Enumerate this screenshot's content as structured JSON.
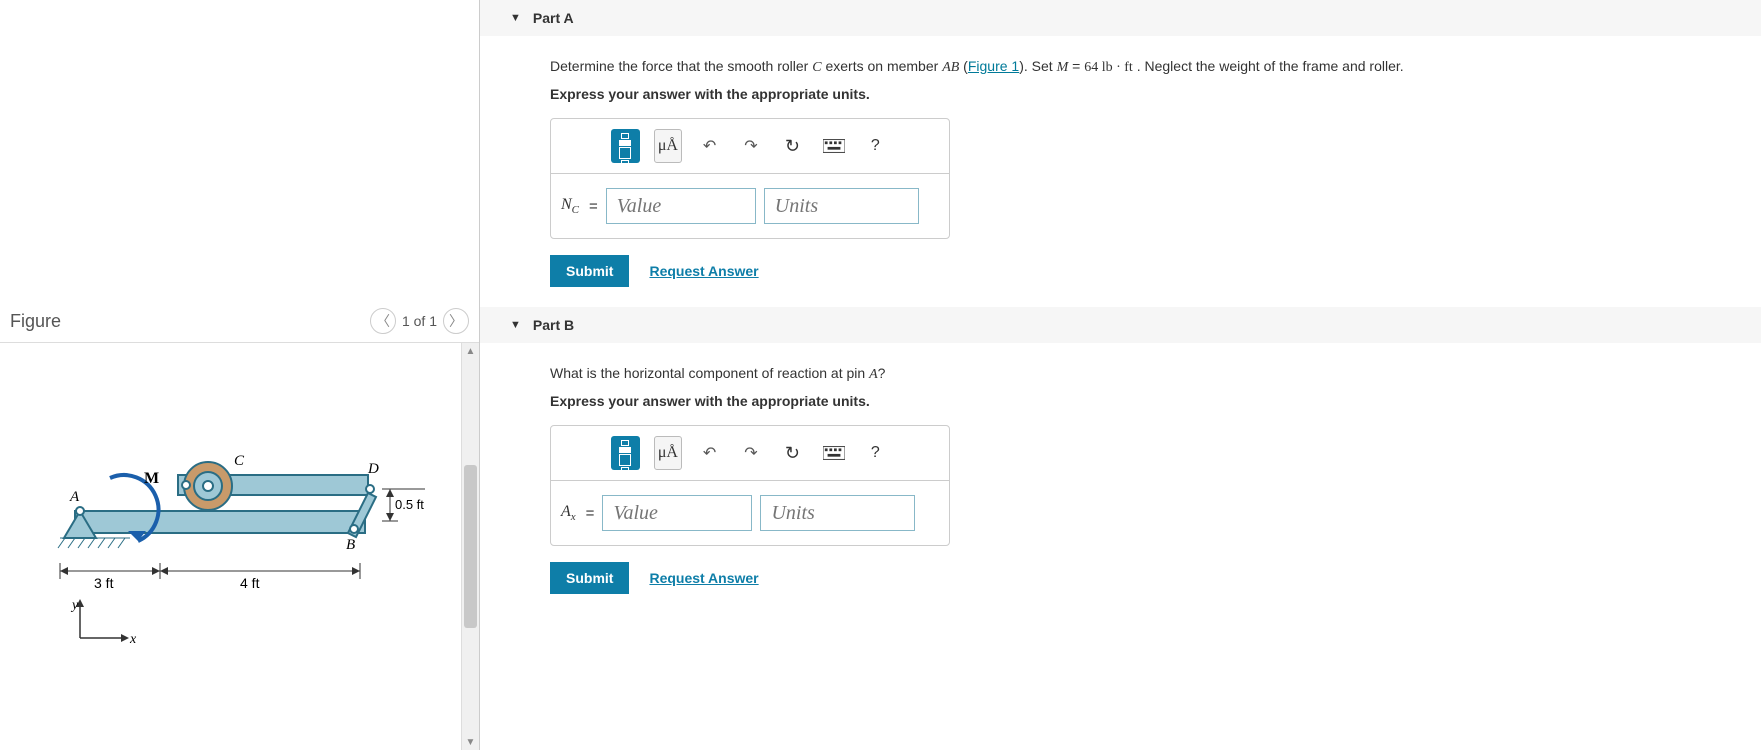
{
  "figure": {
    "title": "Figure",
    "pager": "1 of 1",
    "labels": {
      "A": "A",
      "B": "B",
      "C": "C",
      "D": "D",
      "M": "M",
      "dim1": "3 ft",
      "dim2": "4 ft",
      "dim3": "0.5 ft",
      "axis_x": "x",
      "axis_y": "y"
    }
  },
  "partA": {
    "header": "Part A",
    "q_pre": "Determine the force that the smooth roller ",
    "q_var1": "C",
    "q_mid1": " exerts on member ",
    "q_var2": "AB",
    "q_mid2": " (",
    "q_figlink": "Figure 1",
    "q_mid3": "). Set ",
    "q_eq_lhs": "M",
    "q_eq_eq": " = ",
    "q_eq_rhs": "64 lb · ft",
    "q_post": " . Neglect the weight of the frame and roller.",
    "instr": "Express your answer with the appropriate units.",
    "var_html": "N",
    "var_sub": "C",
    "value_ph": "Value",
    "units_ph": "Units",
    "submit": "Submit",
    "request": "Request Answer",
    "tool_ua": "μÅ",
    "tool_help": "?"
  },
  "partB": {
    "header": "Part B",
    "q_pre": "What is the horizontal component of reaction at pin ",
    "q_var1": "A",
    "q_post": "?",
    "instr": "Express your answer with the appropriate units.",
    "var_html": "A",
    "var_sub": "x",
    "value_ph": "Value",
    "units_ph": "Units",
    "submit": "Submit",
    "request": "Request Answer",
    "tool_ua": "μÅ",
    "tool_help": "?"
  }
}
